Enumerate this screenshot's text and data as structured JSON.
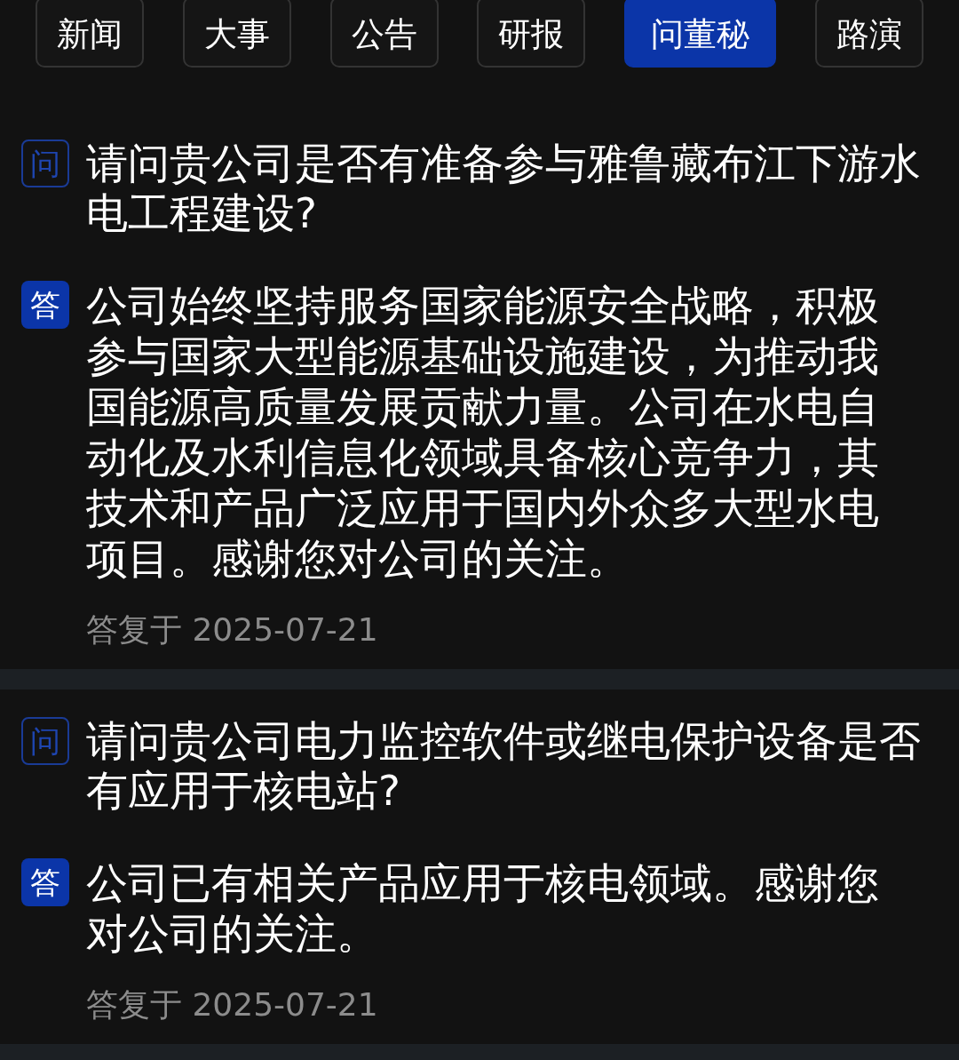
{
  "tabs": [
    {
      "label": "新闻",
      "selected": false
    },
    {
      "label": "大事",
      "selected": false
    },
    {
      "label": "公告",
      "selected": false
    },
    {
      "label": "研报",
      "selected": false
    },
    {
      "label": "问董秘",
      "selected": true
    },
    {
      "label": "路演",
      "selected": false
    }
  ],
  "qa_items": [
    {
      "question_badge": "问",
      "question": "请问贵公司是否有准备参与雅鲁藏布江下游水电工程建设?",
      "answer_badge": "答",
      "answer": "公司始终坚持服务国家能源安全战略，积极参与国家大型能源基础设施建设，为推动我国能源高质量发展贡献力量。公司在水电自动化及水利信息化领域具备核心竞争力，其技术和产品广泛应用于国内外众多大型水电项目。感谢您对公司的关注。",
      "reply_date": "答复于 2025-07-21"
    },
    {
      "question_badge": "问",
      "question": "请问贵公司电力监控软件或继电保护设备是否有应用于核电站?",
      "answer_badge": "答",
      "answer": "公司已有相关产品应用于核电领域。感谢您对公司的关注。",
      "reply_date": "答复于 2025-07-21"
    }
  ]
}
